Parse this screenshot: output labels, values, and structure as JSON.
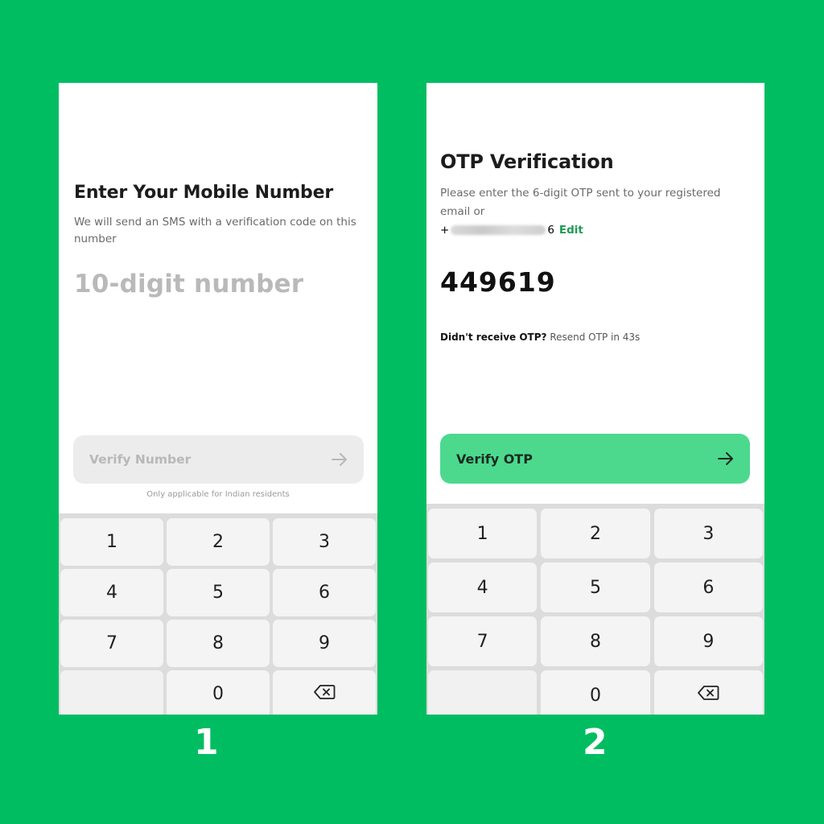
{
  "background_color": "#00bd62",
  "screen1": {
    "title": "Enter Your Mobile Number",
    "subtitle": "We will send an SMS with a verification code on this number",
    "phone_input_placeholder": "10-digit number",
    "verify_button_label": "Verify Number",
    "verify_button_icon": "arrow-right-icon",
    "note": "Only applicable for Indian residents",
    "keypad": [
      "1",
      "2",
      "3",
      "4",
      "5",
      "6",
      "7",
      "8",
      "9",
      "",
      "0",
      "backspace"
    ]
  },
  "screen2": {
    "title": "OTP Verification",
    "subtitle": "Please enter the 6-digit OTP sent to your registered email or",
    "phone_prefix": "+",
    "phone_suffix": "6",
    "edit_label": "Edit",
    "otp_value": "449619",
    "resend_question": "Didn't receive OTP?",
    "resend_text": "Resend OTP in 43s",
    "verify_button_label": "Verify OTP",
    "verify_button_color": "#4cd98e",
    "keypad": [
      "1",
      "2",
      "3",
      "4",
      "5",
      "6",
      "7",
      "8",
      "9",
      "",
      "0",
      "backspace"
    ]
  },
  "step_labels": [
    "1",
    "2"
  ]
}
